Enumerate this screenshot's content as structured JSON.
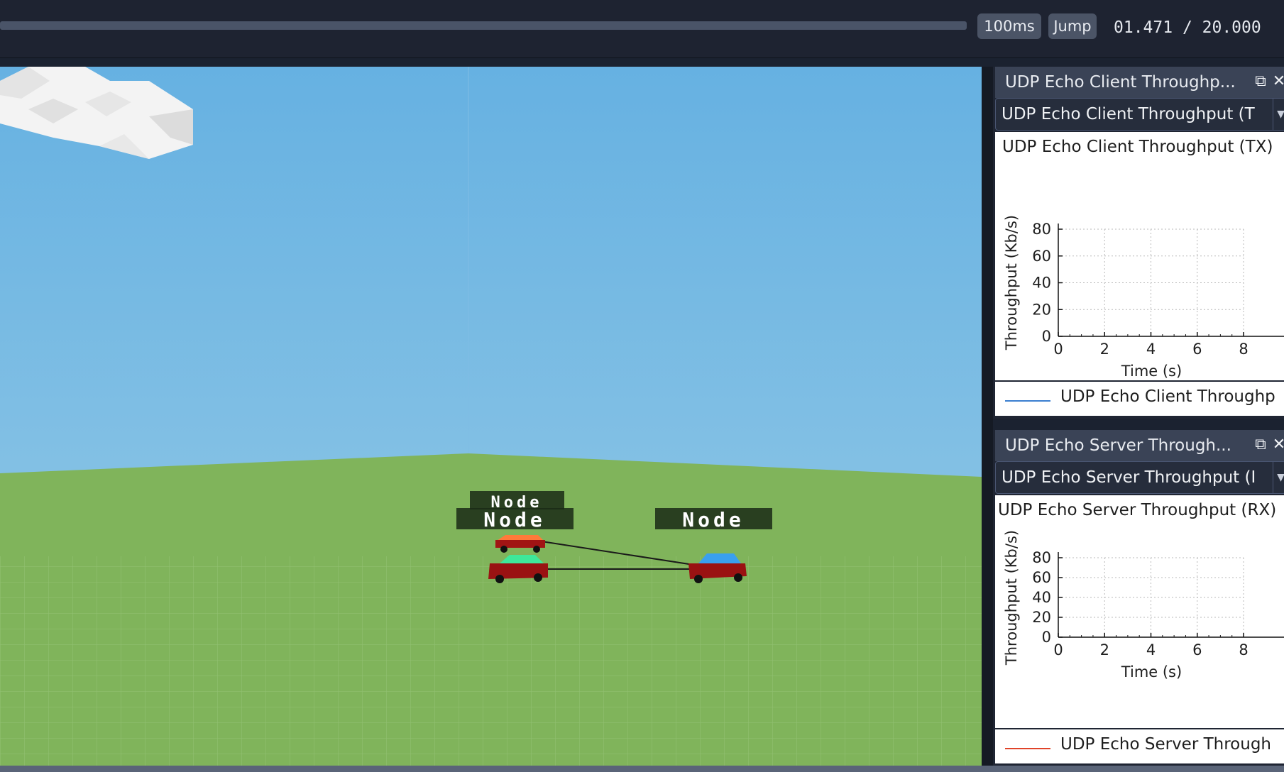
{
  "toolbar": {
    "step_label": "100ms",
    "jump_label": "Jump",
    "time_current": "01.471",
    "time_total": "20.000",
    "time_separator": " / "
  },
  "scene": {
    "nodes": [
      {
        "label": "Node",
        "body_color": "#8b1010",
        "glass_color": "#ff7a3a"
      },
      {
        "label": "Node",
        "body_color": "#8b1010",
        "glass_color": "#3ee89a"
      },
      {
        "label": "Node",
        "body_color": "#8b1010",
        "glass_color": "#3aa0ee"
      }
    ],
    "colors": {
      "sky": "#6fb4e0",
      "ground": "#7fb35a",
      "cloud": "#f0f0f0"
    }
  },
  "panels": [
    {
      "header": "UDP Echo Client Throughp...",
      "float_icon": "float-window-icon",
      "close_icon": "close-icon",
      "selected_series": "UDP Echo Client Throughput (T",
      "legend": "UDP Echo Client Throughp",
      "legend_color": "#3a7fd0"
    },
    {
      "header": "UDP Echo Server Through...",
      "float_icon": "float-window-icon",
      "close_icon": "close-icon",
      "selected_series": "UDP Echo Server Throughput (I",
      "legend": "UDP Echo Server Through",
      "legend_color": "#e0442a"
    }
  ],
  "chart_data": [
    {
      "type": "line",
      "title": "UDP Echo Client Throughput (TX)",
      "xlabel": "Time (s)",
      "ylabel": "Throughput (Kb/s)",
      "xlim": [
        0,
        8
      ],
      "ylim": [
        0,
        80
      ],
      "x_ticks": [
        "0",
        "2",
        "4",
        "6",
        "8"
      ],
      "y_ticks": [
        "0",
        "20",
        "40",
        "60",
        "80"
      ],
      "grid": true,
      "series": [
        {
          "name": "UDP Echo Client Throughp",
          "x": [],
          "y": []
        }
      ]
    },
    {
      "type": "line",
      "title": "UDP Echo Server Throughput (RX)",
      "xlabel": "Time (s)",
      "ylabel": "Throughput (Kb/s)",
      "xlim": [
        0,
        8
      ],
      "ylim": [
        0,
        80
      ],
      "x_ticks": [
        "0",
        "2",
        "4",
        "6",
        "8"
      ],
      "y_ticks": [
        "0",
        "20",
        "40",
        "60",
        "80"
      ],
      "grid": true,
      "series": [
        {
          "name": "UDP Echo Server Through",
          "x": [],
          "y": []
        }
      ]
    }
  ]
}
